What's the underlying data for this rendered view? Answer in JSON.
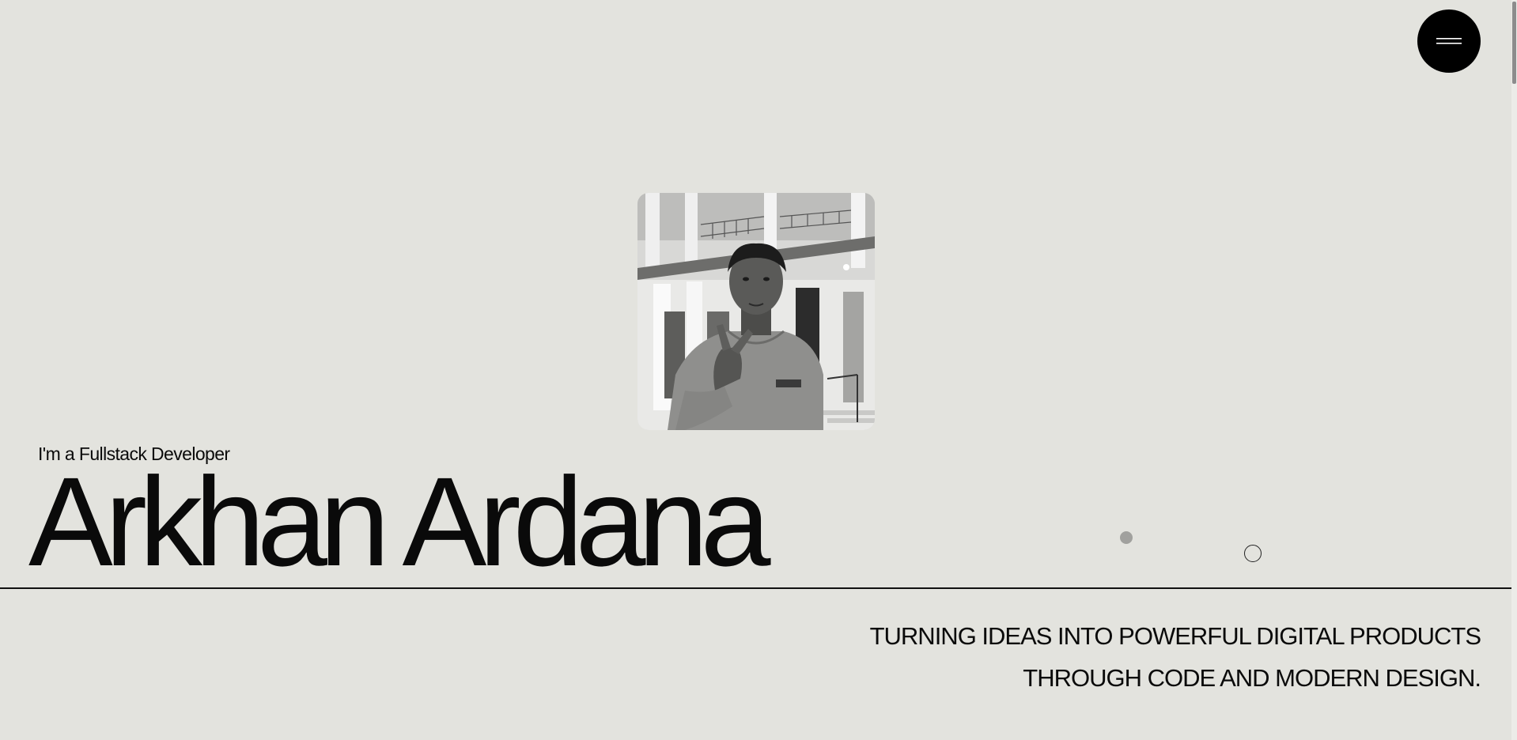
{
  "menu": {
    "icon": "hamburger-menu-icon",
    "color": "#000000"
  },
  "hero": {
    "portrait_icon": "profile-photo",
    "role": "I'm a Fullstack Developer",
    "name": "Arkhan Ardana",
    "tagline_line1": "TURNING IDEAS INTO POWERFUL DIGITAL PRODUCTS",
    "tagline_line2": "THROUGH CODE AND MODERN DESIGN."
  },
  "colors": {
    "background": "#e3e3de",
    "text": "#0a0a0a",
    "accent_dot": "#a1a19e"
  }
}
